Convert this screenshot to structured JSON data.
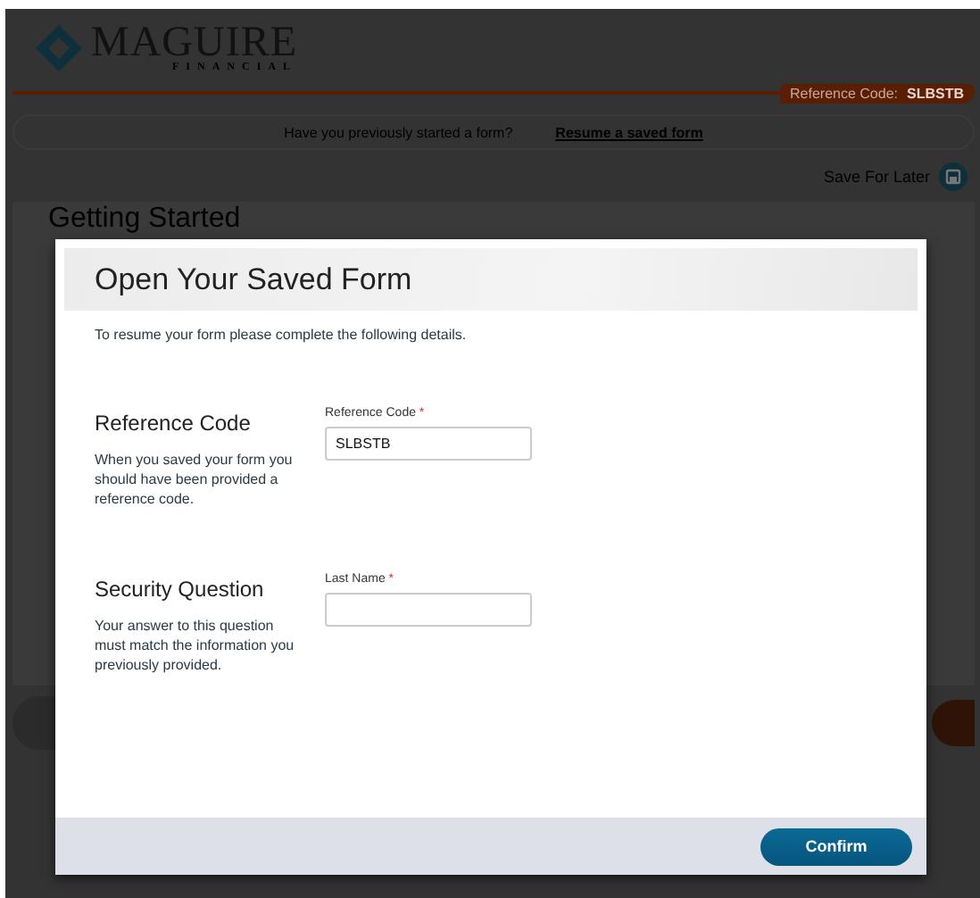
{
  "header": {
    "logo_name": "MAGUIRE",
    "logo_tagline": "FINANCIAL",
    "reference_badge": {
      "label": "Reference Code:",
      "code": "SLBSTB"
    }
  },
  "resume_bar": {
    "question": "Have you previously started a form?",
    "link": "Resume a saved form"
  },
  "save_for_later": "Save For Later",
  "page_title": "Getting Started",
  "modal": {
    "title": "Open Your Saved Form",
    "intro": "To resume your form please complete the following details.",
    "sections": [
      {
        "heading": "Reference Code",
        "description": "When you saved your form you should have been provided a reference code.",
        "field": {
          "label": "Reference Code",
          "required_mark": "*",
          "value": "SLBSTB"
        }
      },
      {
        "heading": "Security Question",
        "description": "Your answer to this question must match the information you previously provided.",
        "field": {
          "label": "Last Name",
          "required_mark": "*"
        }
      }
    ],
    "buttons": [
      {
        "label": "Confirm"
      }
    ]
  }
}
